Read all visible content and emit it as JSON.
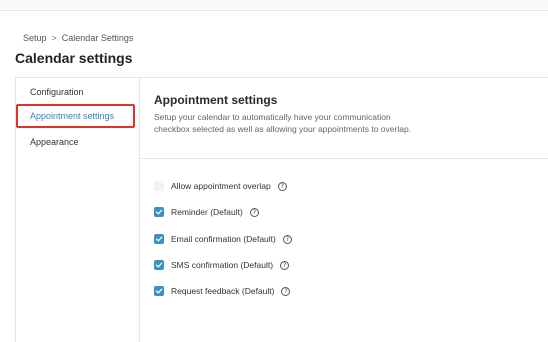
{
  "breadcrumb": {
    "items": [
      "Setup",
      "Calendar Settings"
    ],
    "separator": ">"
  },
  "page": {
    "title": "Calendar settings"
  },
  "sidebar": {
    "items": [
      {
        "label": "Configuration"
      },
      {
        "label": "Appointment settings",
        "active": true
      },
      {
        "label": "Appearance"
      }
    ]
  },
  "main": {
    "title": "Appointment settings",
    "description": "Setup your calendar to automatically have your communication checkbox selected as well as allowing your appointments to overlap.",
    "options": [
      {
        "label": "Allow appointment overlap",
        "checked": false
      },
      {
        "label": "Reminder (Default)",
        "checked": true
      },
      {
        "label": "Email confirmation (Default)",
        "checked": true
      },
      {
        "label": "SMS confirmation (Default)",
        "checked": true
      },
      {
        "label": "Request feedback (Default)",
        "checked": true
      }
    ],
    "help_glyph": "?"
  },
  "colors": {
    "accent": "#3c91c4",
    "active_link": "#2d86b8",
    "highlight": "#e0342b"
  }
}
